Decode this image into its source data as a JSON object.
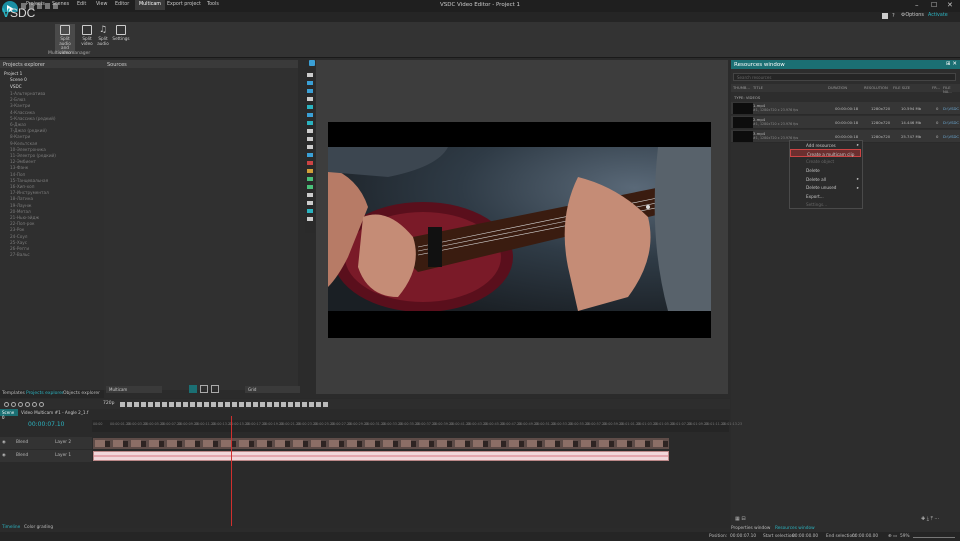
{
  "app": {
    "title": "VSDC Video Editor - Project 1",
    "logo_text_a": "V",
    "logo_text_b": "SDC"
  },
  "window": {
    "min": "–",
    "max": "☐",
    "close": "✕",
    "help_icon": "?",
    "options": "Options",
    "activate": "Activate"
  },
  "menu": {
    "tabs": [
      "Projects",
      "Scenes",
      "Edit",
      "View",
      "Editor",
      "Multicam",
      "Export project",
      "Tools"
    ],
    "active": "Multicam"
  },
  "ribbon": {
    "buttons": [
      "Split audio and video",
      "Split video",
      "Split audio",
      "Settings"
    ],
    "caption": "Multicam manager"
  },
  "projects": {
    "title": "Projects explorer",
    "items": [
      "Project 1",
      "Scene 0",
      "VSDC",
      "1-Альтернатива",
      "2-Блюз",
      "3-Кантри",
      "4-Классика",
      "5-Классика (редкий)",
      "6-Джаз",
      "7-Джаз (редкий)",
      "8-Кантри",
      "9-Кельтская",
      "10-Электроника",
      "11-Электро (редкий)",
      "12-Эмбиент",
      "13-Фанк",
      "14-Поп",
      "15-Танцевальная",
      "16-Хип-хоп",
      "17-Инструментал",
      "18-Латина",
      "19-Лаунж",
      "20-Метал",
      "21-Нью-эйдж",
      "22-Поп-рок",
      "23-Рок",
      "24-Соул",
      "25-Хаус",
      "26-Регги",
      "27-Вальс"
    ]
  },
  "sources": {
    "title": "Sources",
    "combo1": "Multicam",
    "combo2": "Grid"
  },
  "left_tabs": [
    "Templates",
    "Projects explorer",
    "Objects explorer"
  ],
  "resources": {
    "title": "Resources window",
    "search_placeholder": "Search resources",
    "columns": [
      "THUMB...",
      "TITLE",
      "DURATION",
      "RESOLUTION",
      "FILE SIZE",
      "FR...",
      "FILE NA..."
    ],
    "group": "TYPE: VIDEOS",
    "rows": [
      {
        "title": "1.mp4",
        "meta": "#1, 1280x720 x 23.976 fps",
        "duration": "00:00:00:18",
        "res": "1280x720",
        "size": "10.594 Mb",
        "fr": "0",
        "file": "D:\\VSDC"
      },
      {
        "title": "2.mp4",
        "meta": "#1, 1280x720 x 23.976 fps",
        "duration": "00:00:00:18",
        "res": "1280x720",
        "size": "14.446 Mb",
        "fr": "0",
        "file": "D:\\VSDC"
      },
      {
        "title": "3.mp4",
        "meta": "#1, 1280x720 x 23.976 fps",
        "duration": "00:00:00:18",
        "res": "1280x720",
        "size": "25.747 Mb",
        "fr": "0",
        "file": "D:\\VSDC"
      }
    ]
  },
  "context_menu": {
    "items": [
      {
        "label": "Add resources",
        "state": "normal",
        "arrow": "▸"
      },
      {
        "label": "Create a multicam clip",
        "state": "highlight",
        "arrow": ""
      },
      {
        "label": "Create object",
        "state": "disabled",
        "arrow": ""
      },
      {
        "label": "Delete",
        "state": "normal",
        "arrow": ""
      },
      {
        "label": "Delete all",
        "state": "normal",
        "arrow": "▸"
      },
      {
        "label": "Delete unused",
        "state": "normal",
        "arrow": "▸"
      },
      {
        "label": "Export...",
        "state": "normal",
        "arrow": ""
      },
      {
        "label": "Settings...",
        "state": "disabled",
        "arrow": ""
      }
    ]
  },
  "timeline": {
    "quality": "720p",
    "scene_tab": "Scene 0",
    "crumb": "Video Multicam #1 - Angle 2_1.f",
    "timecode": "00:00:07.10",
    "layers": [
      {
        "blend": "Blend",
        "name": "Layer 2"
      },
      {
        "blend": "Blend",
        "name": "Layer 1"
      }
    ],
    "ruler": [
      "00:00",
      "00:00:01.23",
      "00:00:03.23",
      "00:00:05.23",
      "00:00:07.23",
      "00:00:09.23",
      "00:00:11.23",
      "00:00:13.23",
      "00:00:15.23",
      "00:00:17.23",
      "00:00:19.23",
      "00:00:21.23",
      "00:00:23.23",
      "00:00:25.23",
      "00:00:27.23",
      "00:00:29.23",
      "00:00:31.23",
      "00:00:33.23",
      "00:00:35.23",
      "00:00:37.23",
      "00:00:39.23",
      "00:00:41.23",
      "00:00:43.23",
      "00:00:45.23",
      "00:00:47.23",
      "00:00:49.23",
      "00:00:51.23",
      "00:00:53.23",
      "00:00:55.23",
      "00:00:57.23",
      "00:00:59.23",
      "00:01:01.23",
      "00:01:03.23",
      "00:01:05.23",
      "00:01:07.23",
      "00:01:09.23",
      "00:01:11.23",
      "00:01:13.23"
    ]
  },
  "status": {
    "tabs": [
      "Timeline",
      "Color grading"
    ],
    "position_label": "Position:",
    "position": "00:00:07.10",
    "start_label": "Start selection:",
    "start": "00:00:00.00",
    "end_label": "End selection:",
    "end": "00:00:00.00",
    "zoom": "59%"
  },
  "bottom_tabs": [
    "Properties window",
    "Resources window"
  ],
  "colors": {
    "accent": "#1b6f73",
    "playhead": "#d0302e",
    "highlight": "#6a2f2f"
  }
}
